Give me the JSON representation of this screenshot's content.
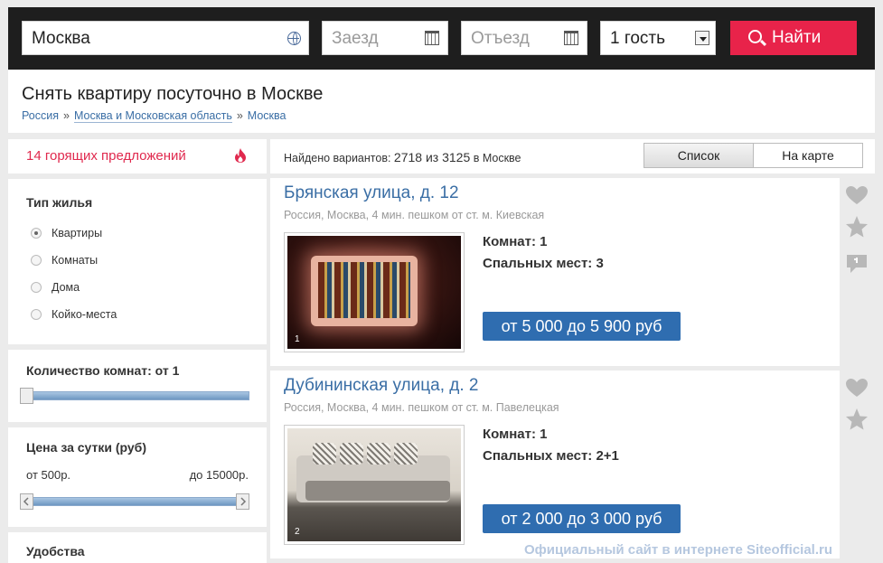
{
  "search": {
    "city_value": "Москва",
    "checkin_placeholder": "Заезд",
    "checkout_placeholder": "Отъезд",
    "guests_value": "1 гость",
    "submit_label": "Найти"
  },
  "header": {
    "title": "Снять квартиру посуточно в Москве",
    "breadcrumbs": [
      "Россия",
      "Москва и Московская область",
      "Москва"
    ],
    "separator": "»"
  },
  "sidebar": {
    "hot_offers": "14 горящих предложений",
    "housing_type": {
      "title": "Тип жилья",
      "options": [
        "Квартиры",
        "Комнаты",
        "Дома",
        "Койко-места"
      ],
      "selected": "Квартиры"
    },
    "rooms": {
      "title": "Количество комнат: от 1",
      "min": 1
    },
    "price": {
      "title": "Цена за сутки (руб)",
      "from_label": "от 500р.",
      "to_label": "до 15000р."
    },
    "amenities": {
      "title": "Удобства"
    }
  },
  "results": {
    "found_prefix": "Найдено вариантов:",
    "found_count": "2718 из 3125",
    "found_suffix": "в Москве",
    "view_tabs": [
      "Список",
      "На карте"
    ],
    "active_tab": "Список"
  },
  "listings": [
    {
      "title": "Брянская улица, д. 12",
      "location": "Россия, Москва, 4 мин. пешком от ст. м. Киевская",
      "photo_number": "1",
      "rooms": "Комнат: 1",
      "beds": "Спальных мест: 3",
      "price": "от 5 000 до 5 900 руб"
    },
    {
      "title": "Дубининская улица, д. 2",
      "location": "Россия, Москва, 4 мин. пешком от ст. м. Павелецкая",
      "photo_number": "2",
      "rooms": "Комнат: 1",
      "beds": "Спальных мест: 2+1",
      "price": "от 2 000 до 3 000 руб"
    }
  ],
  "watermark": "Официальный сайт в интернете Siteofficial.ru",
  "colors": {
    "accent": "#e8234a",
    "link": "#3a6ea5",
    "price_button": "#2f6db0"
  }
}
